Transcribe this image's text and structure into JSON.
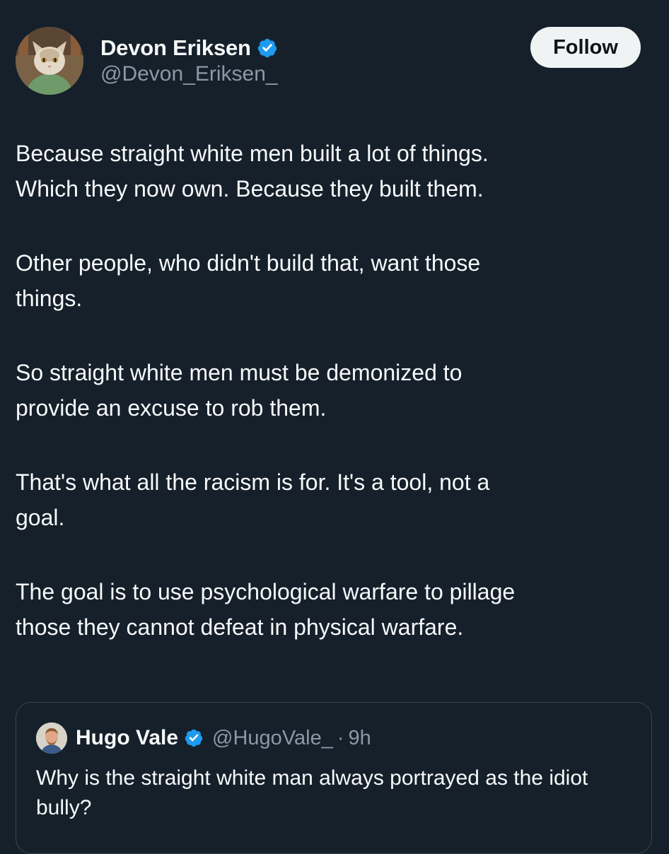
{
  "author": {
    "name": "Devon Eriksen",
    "handle": "@Devon_Eriksen_",
    "verified": true,
    "avatar_icon": "cat-avatar"
  },
  "follow_label": "Follow",
  "tweet": {
    "paragraphs": [
      "Because straight white men built a lot of things.\nWhich they now own. Because they built them.",
      "Other people, who didn't build that, want those\nthings.",
      "So straight white men must be demonized to\nprovide an excuse to rob them.",
      "That's what all the racism is for. It's a tool, not a\ngoal.",
      "The goal is to use psychological warfare to pillage\nthose they cannot defeat in physical warfare."
    ]
  },
  "quoted_tweet": {
    "name": "Hugo Vale",
    "handle": "@HugoVale_",
    "separator": "·",
    "time": "9h",
    "verified": true,
    "text": "Why is the straight white man always portrayed as the idiot bully?"
  },
  "colors": {
    "background": "#15202b",
    "text": "#f7f9f9",
    "secondary_text": "#8b98a5",
    "verified_blue": "#1d9bf0",
    "follow_button_bg": "#eff3f4",
    "border": "#38444d"
  }
}
